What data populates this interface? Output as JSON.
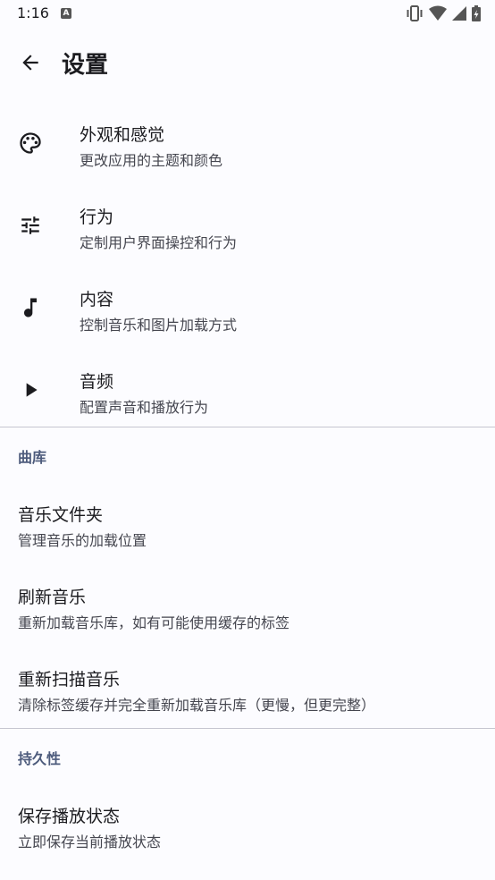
{
  "status_bar": {
    "time": "1:16",
    "notif_glyph": "A"
  },
  "toolbar": {
    "title": "设置"
  },
  "icon_items": [
    {
      "title": "外观和感觉",
      "subtitle": "更改应用的主题和颜色",
      "icon": "palette-icon"
    },
    {
      "title": "行为",
      "subtitle": "定制用户界面操控和行为",
      "icon": "tune-icon"
    },
    {
      "title": "内容",
      "subtitle": "控制音乐和图片加载方式",
      "icon": "music-note-icon"
    },
    {
      "title": "音频",
      "subtitle": "配置声音和播放行为",
      "icon": "play-icon"
    }
  ],
  "library": {
    "header": "曲库",
    "items": [
      {
        "title": "音乐文件夹",
        "subtitle": "管理音乐的加载位置"
      },
      {
        "title": "刷新音乐",
        "subtitle": "重新加载音乐库，如有可能使用缓存的标签"
      },
      {
        "title": "重新扫描音乐",
        "subtitle": "清除标签缓存并完全重新加载音乐库（更慢，但更完整）"
      }
    ]
  },
  "persistence": {
    "header": "持久性",
    "items": [
      {
        "title": "保存播放状态",
        "subtitle": "立即保存当前播放状态"
      }
    ]
  }
}
